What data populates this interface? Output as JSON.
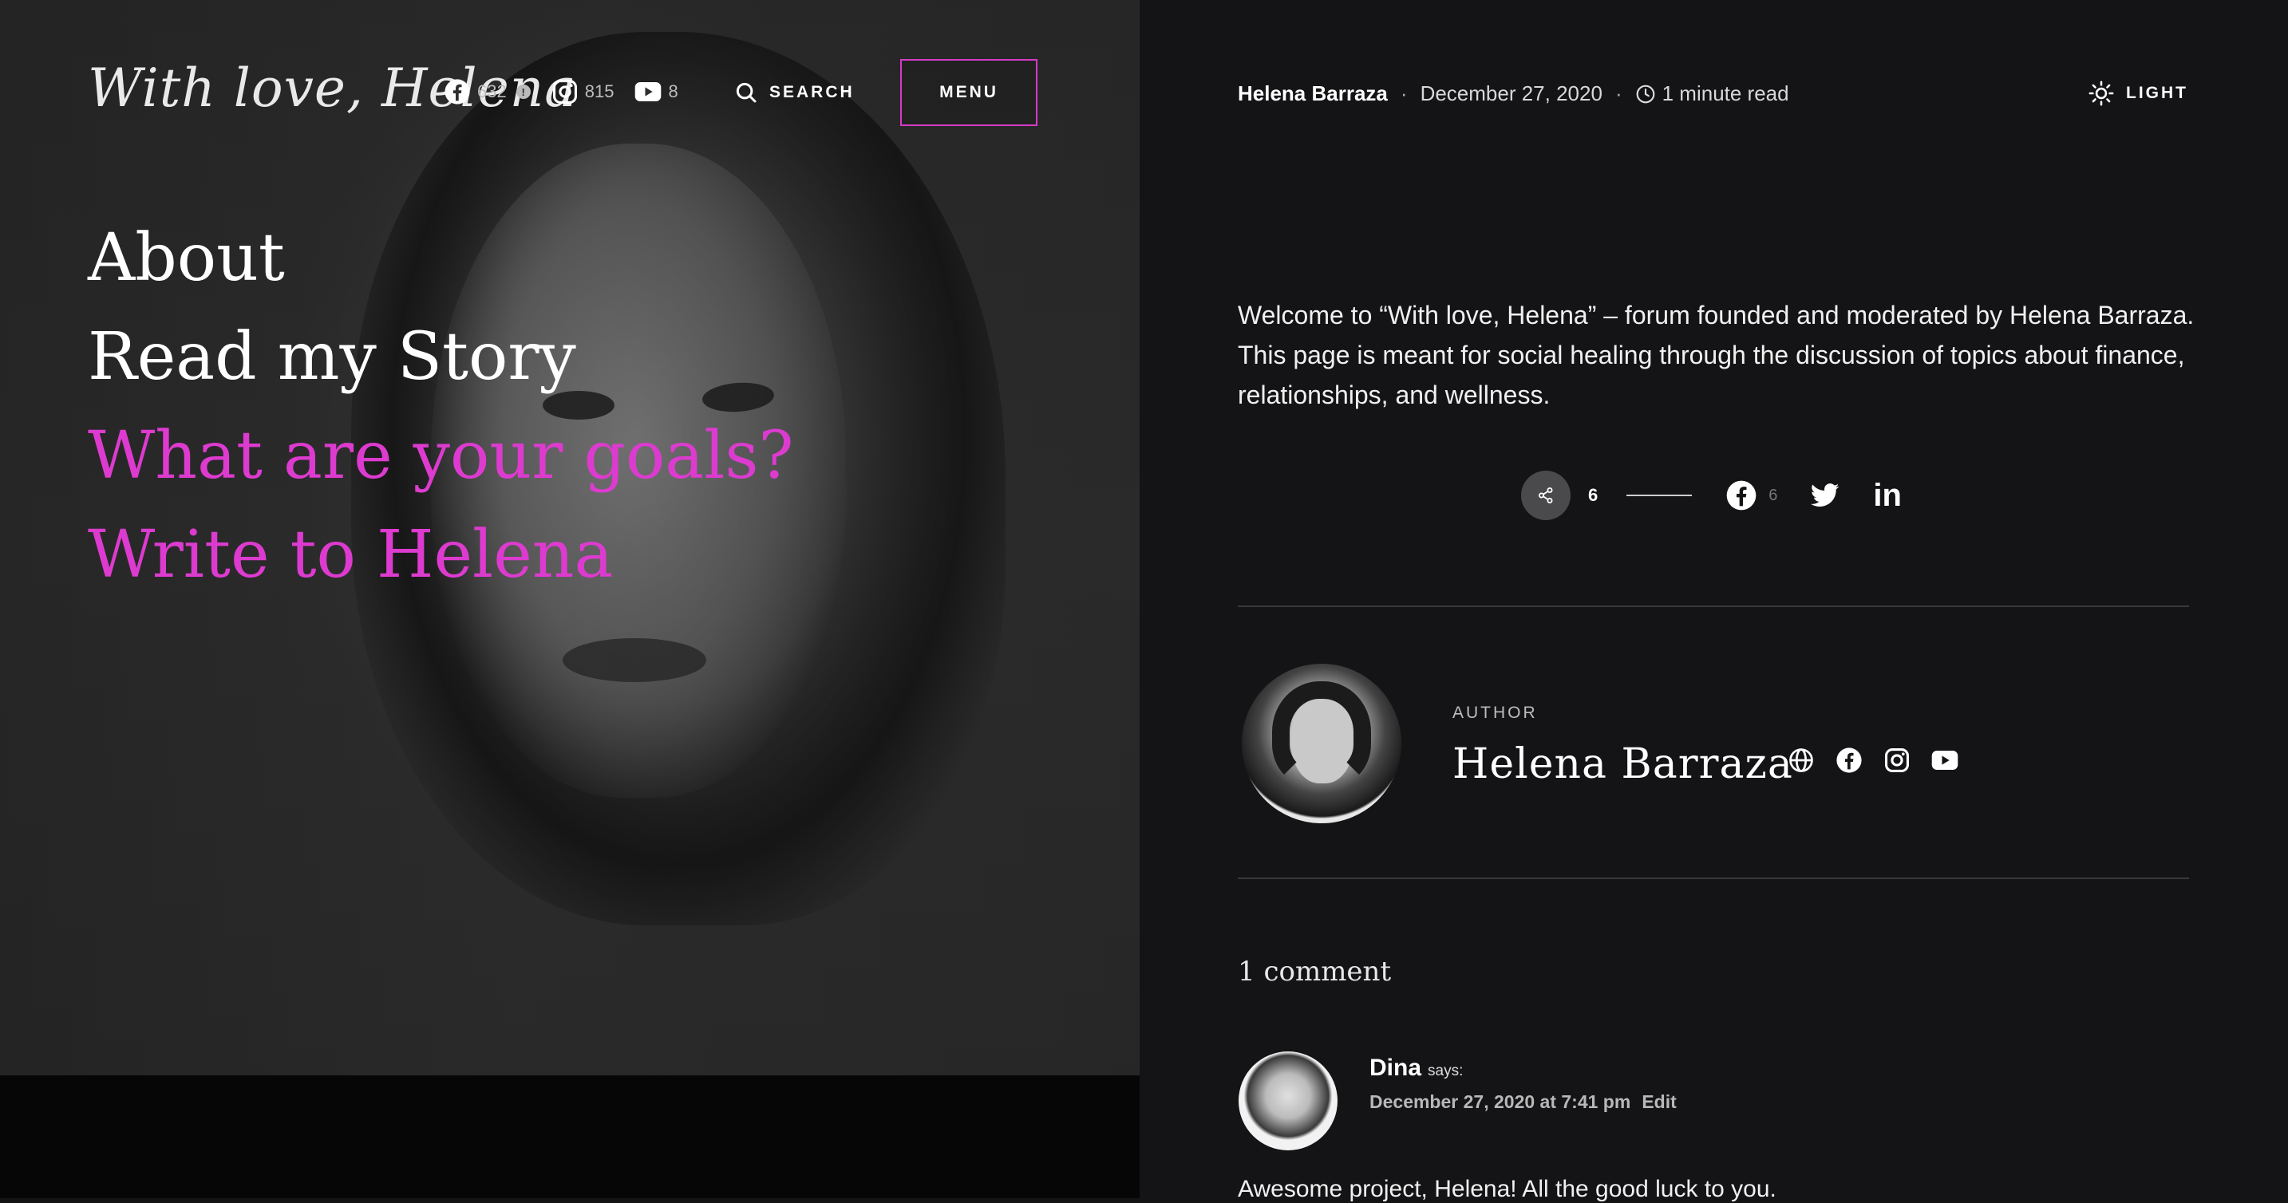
{
  "site": {
    "logo": "With love, Helena"
  },
  "header": {
    "social": [
      {
        "icon": "facebook-icon",
        "count": "632"
      },
      {
        "icon": "instagram-icon",
        "count": "815"
      },
      {
        "icon": "youtube-icon",
        "count": "8"
      }
    ],
    "search_label": "SEARCH",
    "menu_label": "MENU"
  },
  "hero_menu": [
    {
      "label": "About",
      "accent": false
    },
    {
      "label": "Read my Story",
      "accent": false
    },
    {
      "label": "What are your goals?",
      "accent": true
    },
    {
      "label": "Write to Helena",
      "accent": true
    }
  ],
  "post_meta": {
    "author": "Helena Barraza",
    "date": "December 27, 2020",
    "read_time": "1 minute read"
  },
  "theme_toggle": {
    "label": "LIGHT"
  },
  "intro_text": "Welcome to “With love, Helena” – forum founded and moderated by Helena Barraza. This page is meant for social healing through the discussion of topics about finance, relationships, and wellness.",
  "share": {
    "total": "6",
    "facebook_count": "6"
  },
  "author_box": {
    "label": "AUTHOR",
    "name": "Helena Barraza",
    "icons": [
      "globe-icon",
      "facebook-icon",
      "instagram-icon",
      "youtube-icon"
    ]
  },
  "comments": {
    "title": "1 comment",
    "items": [
      {
        "name": "Dina",
        "says": "says:",
        "date": "December 27, 2020 at 7:41 pm",
        "edit": "Edit",
        "text": "Awesome project, Helena! All the good luck to you."
      }
    ]
  },
  "colors": {
    "accent": "#dd3bcf",
    "background": "#141416"
  }
}
